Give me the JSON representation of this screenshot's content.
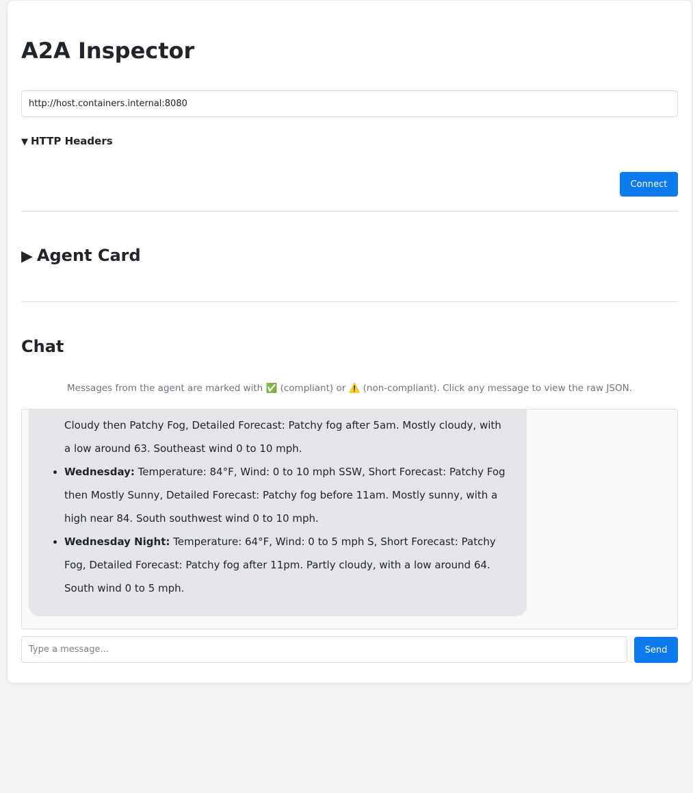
{
  "app": {
    "title": "A2A Inspector"
  },
  "connection": {
    "url": "http://host.containers.internal:8080",
    "headers_toggle_icon": "▼",
    "headers_label": "HTTP Headers",
    "connect_label": "Connect"
  },
  "agent_card": {
    "toggle_icon": "▶",
    "label": "Agent Card"
  },
  "chat": {
    "title": "Chat",
    "note": "Messages from the agent are marked with ✅ (compliant) or ⚠️ (non-compliant). Click any message to view the raw JSON.",
    "message": {
      "partial_text": "Cloudy then Patchy Fog, Detailed Forecast: Patchy fog after 5am. Mostly cloudy, with a low around 63. Southeast wind 0 to 10 mph.",
      "items": [
        {
          "label": "Wednesday:",
          "text": "Temperature: 84°F, Wind: 0 to 10 mph SSW, Short Forecast: Patchy Fog then Mostly Sunny, Detailed Forecast: Patchy fog before 11am. Mostly sunny, with a high near 84. South southwest wind 0 to 10 mph."
        },
        {
          "label": "Wednesday Night:",
          "text": "Temperature: 64°F, Wind: 0 to 5 mph S, Short Forecast: Patchy Fog, Detailed Forecast: Patchy fog after 11pm. Partly cloudy, with a low around 64. South wind 0 to 5 mph."
        }
      ]
    },
    "input_placeholder": "Type a message...",
    "send_label": "Send"
  },
  "colors": {
    "accent": "#0d7bf0",
    "page_background": "#f4f4f6",
    "bubble_background": "#e4e5ea"
  }
}
